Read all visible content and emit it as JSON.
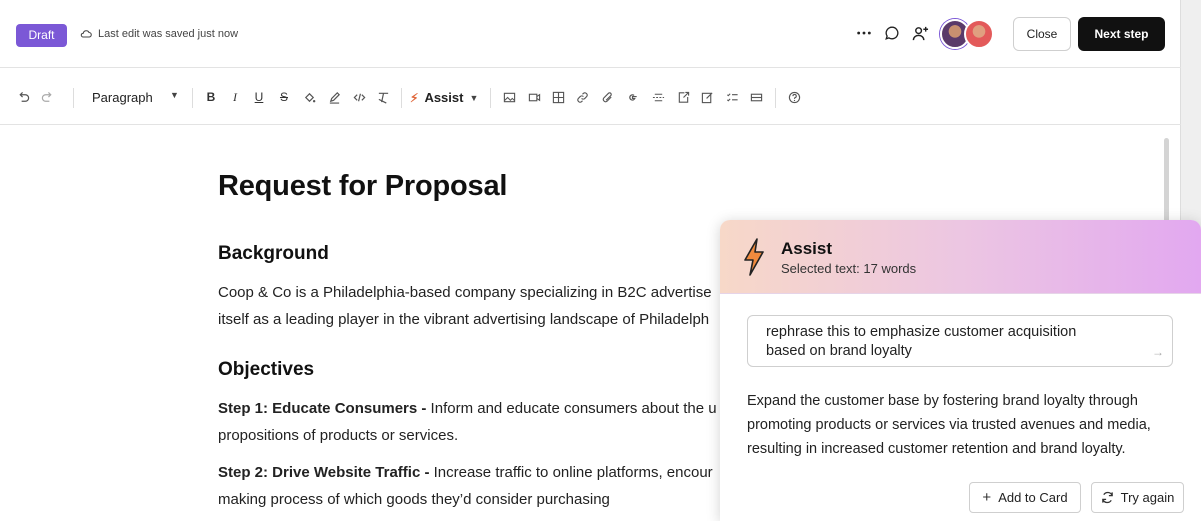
{
  "header": {
    "status_badge": "Draft",
    "save_status": "Last edit was saved just now",
    "close_label": "Close",
    "next_label": "Next step"
  },
  "toolbar": {
    "block_type": "Paragraph",
    "assist_label": "Assist"
  },
  "document": {
    "title": "Request for Proposal",
    "background_heading": "Background",
    "background_line1": "Coop & Co is a Philadelphia-based company specializing in B2C advertise",
    "background_line2": "itself as a leading player in the vibrant advertising landscape of Philadelph",
    "objectives_heading": "Objectives",
    "step1_label": "Step 1: Educate Consumers -",
    "step1_text1": " Inform and educate consumers about the u",
    "step1_text2": "propositions of products or services.",
    "step2_label": "Step 2: Drive Website Traffic -",
    "step2_text1": " Increase traffic to online platforms, encour",
    "step2_text2": "making process of which goods they’d consider purchasing"
  },
  "assist_panel": {
    "title": "Assist",
    "subtitle": "Selected text: 17 words",
    "prompt_line1": "rephrase this to emphasize customer acquisition",
    "prompt_line2": "based on brand loyalty",
    "result": "Expand the customer base by fostering brand loyalty through promoting products or services via trusted avenues and media, resulting in increased customer retention and brand loyalty.",
    "add_label": "Add to Card",
    "retry_label": "Try again"
  },
  "colors": {
    "brand": "#7b58d6",
    "primary_button": "#111111",
    "assist_bolt": "#e0683c"
  }
}
